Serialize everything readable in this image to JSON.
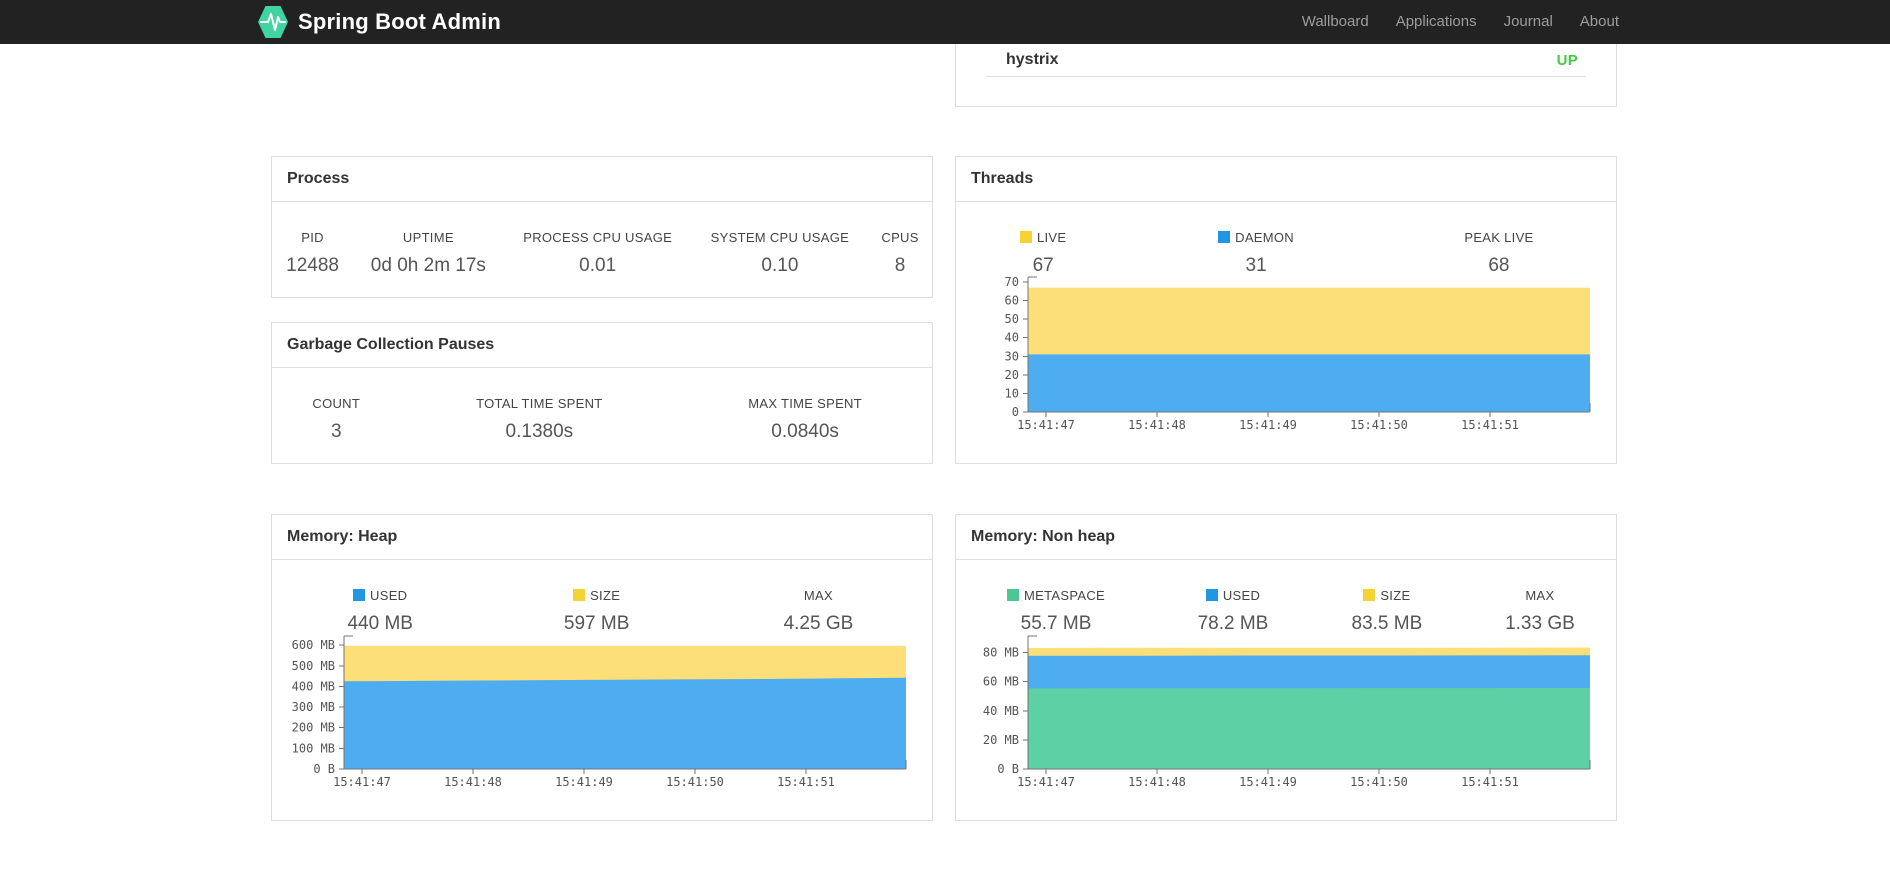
{
  "navbar": {
    "brand": "Spring Boot Admin",
    "items": [
      {
        "label": "Wallboard"
      },
      {
        "label": "Applications"
      },
      {
        "label": "Journal"
      },
      {
        "label": "About"
      }
    ]
  },
  "status_panel": {
    "application": "hystrix",
    "status": "UP",
    "status_color": "#44cc44"
  },
  "panels": {
    "process": {
      "title": "Process",
      "metrics": [
        {
          "label": "PID",
          "value": "12488"
        },
        {
          "label": "UPTIME",
          "value": "0d 0h 2m 17s"
        },
        {
          "label": "PROCESS CPU USAGE",
          "value": "0.01"
        },
        {
          "label": "SYSTEM CPU USAGE",
          "value": "0.10"
        },
        {
          "label": "CPUS",
          "value": "8"
        }
      ]
    },
    "gc": {
      "title": "Garbage Collection Pauses",
      "metrics": [
        {
          "label": "COUNT",
          "value": "3"
        },
        {
          "label": "TOTAL TIME SPENT",
          "value": "0.1380s"
        },
        {
          "label": "MAX TIME SPENT",
          "value": "0.0840s"
        }
      ]
    },
    "threads": {
      "title": "Threads",
      "legend": [
        {
          "label": "LIVE",
          "value": "67",
          "color": "#f5d335"
        },
        {
          "label": "DAEMON",
          "value": "31",
          "color": "#2196e3"
        },
        {
          "label": "PEAK LIVE",
          "value": "68",
          "color": ""
        }
      ]
    },
    "heap": {
      "title": "Memory: Heap",
      "legend": [
        {
          "label": "USED",
          "value": "440 MB",
          "color": "#2196e3"
        },
        {
          "label": "SIZE",
          "value": "597 MB",
          "color": "#f5d335"
        },
        {
          "label": "MAX",
          "value": "4.25 GB",
          "color": ""
        }
      ]
    },
    "nonheap": {
      "title": "Memory: Non heap",
      "legend": [
        {
          "label": "METASPACE",
          "value": "55.7 MB",
          "color": "#4ac795"
        },
        {
          "label": "USED",
          "value": "78.2 MB",
          "color": "#2196e3"
        },
        {
          "label": "SIZE",
          "value": "83.5 MB",
          "color": "#f5d335"
        },
        {
          "label": "MAX",
          "value": "1.33 GB",
          "color": ""
        }
      ]
    }
  },
  "chart_data": [
    {
      "type": "area",
      "stacked": true,
      "title": "Threads",
      "legend_position": "top",
      "grid": false,
      "x_ticks": [
        "15:41:47",
        "15:41:48",
        "15:41:49",
        "15:41:50",
        "15:41:51"
      ],
      "ymax": 70,
      "y_ticks": [
        {
          "value": 0,
          "label": "0"
        },
        {
          "value": 10,
          "label": "10"
        },
        {
          "value": 20,
          "label": "20"
        },
        {
          "value": 30,
          "label": "30"
        },
        {
          "value": 40,
          "label": "40"
        },
        {
          "value": 50,
          "label": "50"
        },
        {
          "value": 60,
          "label": "60"
        },
        {
          "value": 70,
          "label": "70"
        }
      ],
      "bands": [
        {
          "name": "DAEMON",
          "fill": "#4dadf0",
          "tops": [
            31,
            31,
            31,
            31,
            31,
            31
          ]
        },
        {
          "name": "LIVE",
          "fill": "#fcdf78",
          "tops": [
            67,
            67,
            67,
            67,
            67,
            67
          ]
        }
      ]
    },
    {
      "type": "area",
      "stacked": true,
      "title": "Memory: Heap",
      "legend_position": "top",
      "grid": false,
      "x_ticks": [
        "15:41:47",
        "15:41:48",
        "15:41:49",
        "15:41:50",
        "15:41:51"
      ],
      "ymax": 620,
      "y_ticks": [
        {
          "value": 0,
          "label": "0 B"
        },
        {
          "value": 100,
          "label": "100 MB"
        },
        {
          "value": 200,
          "label": "200 MB"
        },
        {
          "value": 300,
          "label": "300 MB"
        },
        {
          "value": 400,
          "label": "400 MB"
        },
        {
          "value": 500,
          "label": "500 MB"
        },
        {
          "value": 600,
          "label": "600 MB"
        }
      ],
      "bands": [
        {
          "name": "USED",
          "fill": "#4dadf0",
          "tops": [
            425,
            428,
            431,
            434,
            437,
            442
          ]
        },
        {
          "name": "SIZE",
          "fill": "#fcdf78",
          "tops": [
            597,
            597,
            597,
            597,
            597,
            597
          ]
        }
      ]
    },
    {
      "type": "area",
      "stacked": true,
      "title": "Memory: Non heap",
      "legend_position": "top",
      "grid": false,
      "x_ticks": [
        "15:41:47",
        "15:41:48",
        "15:41:49",
        "15:41:50",
        "15:41:51"
      ],
      "ymax": 88,
      "y_ticks": [
        {
          "value": 0,
          "label": "0 B"
        },
        {
          "value": 20,
          "label": "20 MB"
        },
        {
          "value": 40,
          "label": "40 MB"
        },
        {
          "value": 60,
          "label": "60 MB"
        },
        {
          "value": 80,
          "label": "80 MB"
        }
      ],
      "bands": [
        {
          "name": "METASPACE",
          "fill": "#5ed0a5",
          "tops": [
            55.4,
            55.5,
            55.5,
            55.6,
            55.6,
            55.7
          ]
        },
        {
          "name": "USED",
          "fill": "#4dadf0",
          "tops": [
            77.8,
            77.9,
            78.0,
            78.0,
            78.1,
            78.2
          ]
        },
        {
          "name": "SIZE",
          "fill": "#fcdf78",
          "tops": [
            83.2,
            83.3,
            83.3,
            83.4,
            83.4,
            83.5
          ]
        }
      ]
    }
  ]
}
